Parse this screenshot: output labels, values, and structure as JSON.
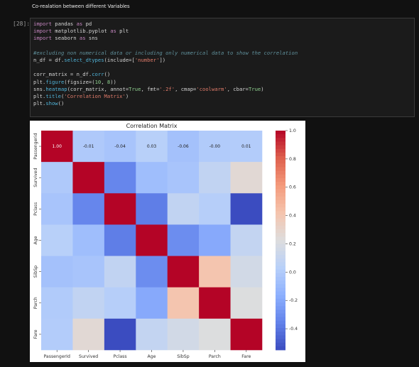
{
  "header": {
    "title": "Co-realation between different Variables"
  },
  "cell": {
    "prompt": "[28]:",
    "lines": [
      [
        {
          "t": "import",
          "c": "kw"
        },
        {
          "t": " pandas ",
          "c": "op"
        },
        {
          "t": "as",
          "c": "kw"
        },
        {
          "t": " pd",
          "c": "op"
        }
      ],
      [
        {
          "t": "import",
          "c": "kw"
        },
        {
          "t": " matplotlib.pyplot ",
          "c": "op"
        },
        {
          "t": "as",
          "c": "kw"
        },
        {
          "t": " plt",
          "c": "op"
        }
      ],
      [
        {
          "t": "import",
          "c": "kw"
        },
        {
          "t": " seaborn ",
          "c": "op"
        },
        {
          "t": "as",
          "c": "kw"
        },
        {
          "t": " sns",
          "c": "op"
        }
      ],
      [
        {
          "t": "",
          "c": "op"
        }
      ],
      [
        {
          "t": "#excluding non numerical data or including only numerical data to show the correlation",
          "c": "cm"
        }
      ],
      [
        {
          "t": "n_df = df.",
          "c": "op"
        },
        {
          "t": "select_dtypes",
          "c": "fn"
        },
        {
          "t": "(include=[",
          "c": "op"
        },
        {
          "t": "'number'",
          "c": "st"
        },
        {
          "t": "])",
          "c": "op"
        }
      ],
      [
        {
          "t": "",
          "c": "op"
        }
      ],
      [
        {
          "t": "corr_matrix = n_df.",
          "c": "op"
        },
        {
          "t": "corr",
          "c": "fn"
        },
        {
          "t": "()",
          "c": "op"
        }
      ],
      [
        {
          "t": "plt.",
          "c": "op"
        },
        {
          "t": "figure",
          "c": "fn"
        },
        {
          "t": "(figsize=(",
          "c": "op"
        },
        {
          "t": "10",
          "c": "nb"
        },
        {
          "t": ", ",
          "c": "op"
        },
        {
          "t": "8",
          "c": "nb"
        },
        {
          "t": "))",
          "c": "op"
        }
      ],
      [
        {
          "t": "sns.",
          "c": "op"
        },
        {
          "t": "heatmap",
          "c": "fn"
        },
        {
          "t": "(corr_matrix, annot=",
          "c": "op"
        },
        {
          "t": "True",
          "c": "nb"
        },
        {
          "t": ", fmt=",
          "c": "op"
        },
        {
          "t": "'.2f'",
          "c": "st"
        },
        {
          "t": ", cmap=",
          "c": "op"
        },
        {
          "t": "'coolwarm'",
          "c": "st"
        },
        {
          "t": ", cbar=",
          "c": "op"
        },
        {
          "t": "True",
          "c": "nb"
        },
        {
          "t": ")",
          "c": "op"
        }
      ],
      [
        {
          "t": "plt.",
          "c": "op"
        },
        {
          "t": "title",
          "c": "fn"
        },
        {
          "t": "(",
          "c": "op"
        },
        {
          "t": "'Correlation Matrix'",
          "c": "st"
        },
        {
          "t": ")",
          "c": "op"
        }
      ],
      [
        {
          "t": "plt.",
          "c": "op"
        },
        {
          "t": "show",
          "c": "fn"
        },
        {
          "t": "()",
          "c": "op"
        }
      ]
    ]
  },
  "colors": {
    "coolwarm_low": "#3b4cc0",
    "coolwarm_mid": "#dddddd",
    "coolwarm_high": "#b40426"
  },
  "chart_data": {
    "type": "heatmap",
    "title": "Correlation Matrix",
    "categories": [
      "PassengerId",
      "Survived",
      "Pclass",
      "Age",
      "SibSp",
      "Parch",
      "Fare"
    ],
    "y_tick_labels": [
      "Passengerid",
      "Survived",
      "Pclass",
      "Age",
      "SibSp",
      "Parch",
      "Fare"
    ],
    "x_tick_labels": [
      "PassengerId",
      "Survived",
      "Pclass",
      "Age",
      "SibSp",
      "Parch",
      "Fare"
    ],
    "values": [
      [
        1.0,
        -0.01,
        -0.04,
        0.03,
        -0.06,
        -0.0,
        0.01
      ],
      [
        -0.01,
        1.0,
        -0.34,
        -0.08,
        -0.04,
        0.08,
        0.26
      ],
      [
        -0.04,
        -0.34,
        1.0,
        -0.37,
        0.08,
        0.02,
        -0.55
      ],
      [
        0.03,
        -0.08,
        -0.37,
        1.0,
        -0.31,
        -0.19,
        0.09
      ],
      [
        -0.06,
        -0.04,
        0.08,
        -0.31,
        1.0,
        0.41,
        0.16
      ],
      [
        -0.0,
        0.08,
        0.02,
        -0.19,
        0.41,
        1.0,
        0.22
      ],
      [
        0.01,
        0.26,
        -0.55,
        0.09,
        0.16,
        0.22,
        1.0
      ]
    ],
    "annotations": [
      "1.00",
      "-0.01",
      "-0.04",
      "0.03",
      "-0.06",
      "-0.00",
      "0.01"
    ],
    "colorbar": {
      "vmin": -0.55,
      "vmax": 1.0,
      "ticks": [
        "1.0",
        "0.8",
        "0.6",
        "0.4",
        "0.2",
        "0.0",
        "-0.2",
        "-0.4"
      ],
      "tick_values": [
        1.0,
        0.8,
        0.6,
        0.4,
        0.2,
        0.0,
        -0.2,
        -0.4
      ]
    },
    "cmap": "coolwarm",
    "grid": false
  }
}
